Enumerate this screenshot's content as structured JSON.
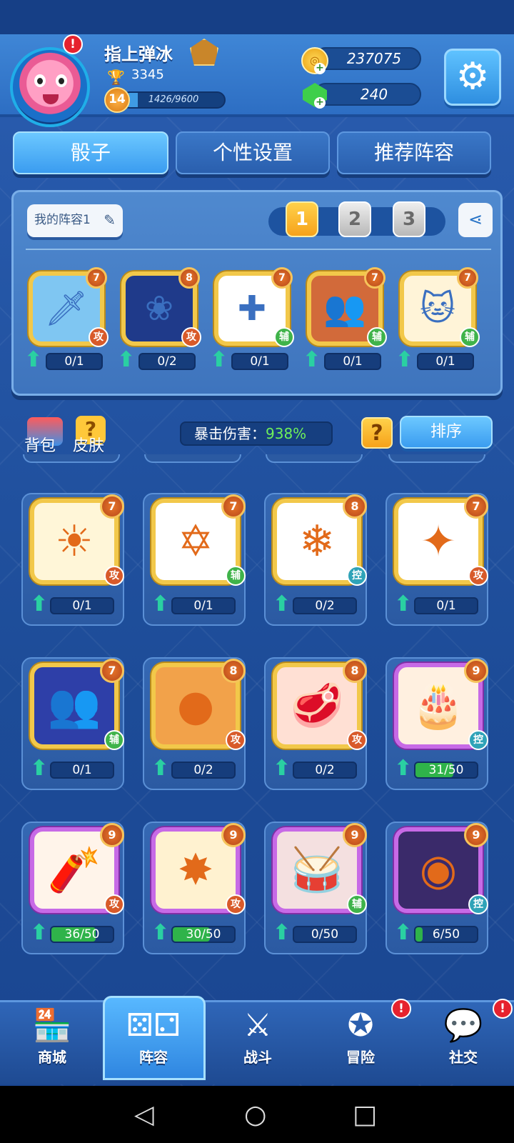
{
  "player": {
    "name": "指上弹冰",
    "trophies": "3345",
    "level": "14",
    "xp_text": "1426/9600",
    "xp_fraction": 0.149
  },
  "currency": {
    "gold": "237075",
    "gems": "240"
  },
  "tabs": [
    "骰子",
    "个性设置",
    "推荐阵容"
  ],
  "lineup": {
    "label": "我的阵容1",
    "slots": [
      "1",
      "2",
      "3"
    ],
    "active_slot": "1",
    "dice": [
      {
        "icon": "sword-ice-icon",
        "level": "7",
        "tag": "攻",
        "progress": "0/1",
        "color": "#7fc6f2"
      },
      {
        "icon": "lotus-icon",
        "level": "8",
        "tag": "攻",
        "progress": "0/2",
        "color": "#1f3a8a"
      },
      {
        "icon": "healing-cross-icon",
        "level": "7",
        "tag": "辅",
        "progress": "0/1",
        "color": "#ffffff"
      },
      {
        "icon": "silhouette-icon",
        "level": "7",
        "tag": "辅",
        "progress": "0/1",
        "color": "#d26a3a"
      },
      {
        "icon": "lucky-cat-icon",
        "level": "7",
        "tag": "辅",
        "progress": "0/1",
        "color": "#fff4d8"
      }
    ]
  },
  "toolbar": {
    "bag": "背包",
    "skin": "皮肤",
    "crit_label": "暴击伤害：",
    "crit_value": "938%",
    "help": "?",
    "sort": "排序"
  },
  "collection": [
    {
      "icon": "sun-icon",
      "level": "7",
      "tag": "攻",
      "progress": "0/1",
      "frame": "gold",
      "bg": "#fff6d8",
      "fill": 0
    },
    {
      "icon": "magic-circle-icon",
      "level": "7",
      "tag": "辅",
      "progress": "0/1",
      "frame": "gold",
      "bg": "#ffffff",
      "fill": 0
    },
    {
      "icon": "snowflake-icon",
      "level": "8",
      "tag": "控",
      "progress": "0/2",
      "frame": "gold",
      "bg": "#ffffff",
      "fill": 0
    },
    {
      "icon": "ice-crystal-icon",
      "level": "7",
      "tag": "攻",
      "progress": "0/1",
      "frame": "gold",
      "bg": "#ffffff",
      "fill": 0
    },
    {
      "icon": "silhouette-icon",
      "level": "7",
      "tag": "辅",
      "progress": "0/1",
      "frame": "gold",
      "bg": "#2e3fa8",
      "fill": 0
    },
    {
      "icon": "grenade-icon",
      "level": "8",
      "tag": "攻",
      "progress": "0/2",
      "frame": "gold",
      "bg": "#f2a24a",
      "fill": 0
    },
    {
      "icon": "meat-icon",
      "level": "8",
      "tag": "攻",
      "progress": "0/2",
      "frame": "gold",
      "bg": "#ffe0d4",
      "fill": 0
    },
    {
      "icon": "cake-icon",
      "level": "9",
      "tag": "控",
      "progress": "31/50",
      "frame": "purple",
      "bg": "#fff0e0",
      "fill": 0.62
    },
    {
      "icon": "firecracker-icon",
      "level": "9",
      "tag": "攻",
      "progress": "36/50",
      "frame": "purple",
      "bg": "#fff4ea",
      "fill": 0.72
    },
    {
      "icon": "explosion-icon",
      "level": "9",
      "tag": "攻",
      "progress": "30/50",
      "frame": "purple",
      "bg": "#fff2d0",
      "fill": 0.6
    },
    {
      "icon": "drum-icon",
      "level": "9",
      "tag": "辅",
      "progress": "0/50",
      "frame": "purple",
      "bg": "#f4e0e0",
      "fill": 0
    },
    {
      "icon": "vortex-eye-icon",
      "level": "9",
      "tag": "控",
      "progress": "6/50",
      "frame": "purple",
      "bg": "#3a2a6a",
      "fill": 0.12
    }
  ],
  "nav": [
    {
      "label": "商城",
      "icon": "shop-icon"
    },
    {
      "label": "阵容",
      "icon": "dice-icon"
    },
    {
      "label": "战斗",
      "icon": "crossed-swords-icon"
    },
    {
      "label": "冒险",
      "icon": "adventure-icon"
    },
    {
      "label": "社交",
      "icon": "chat-icon"
    }
  ],
  "alert": "!"
}
